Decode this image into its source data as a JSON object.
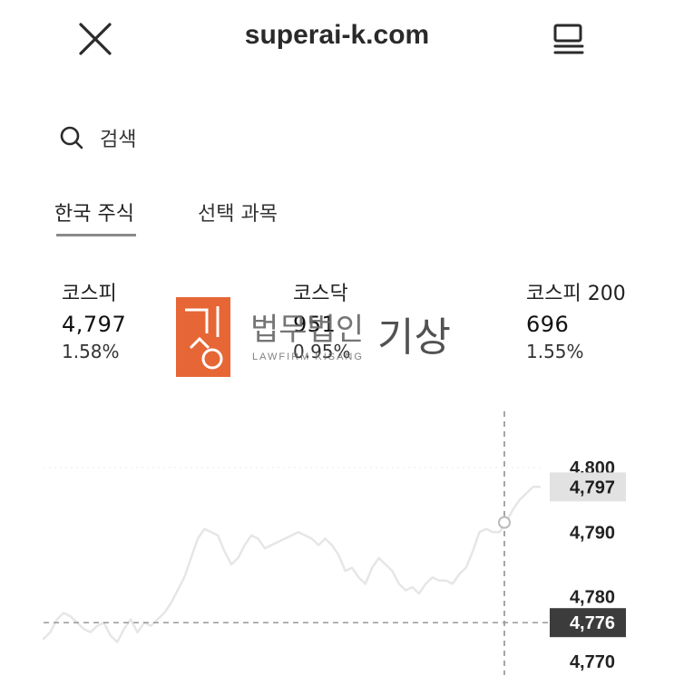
{
  "header": {
    "site_title": "superai-k.com",
    "close_icon": "close-icon",
    "menu_icon": "menu-icon"
  },
  "search": {
    "label": "검색",
    "icon": "search-icon"
  },
  "tabs": [
    {
      "label": "한국 주식",
      "active": true
    },
    {
      "label": "선택 과목",
      "active": false
    }
  ],
  "indices": [
    {
      "name": "코스피",
      "value": "4,797",
      "change": "1.58%"
    },
    {
      "name": "코스닥",
      "value": "951",
      "change": "0.95%"
    },
    {
      "name": "코스피 200",
      "value": "696",
      "change": "1.55%"
    }
  ],
  "watermark": {
    "name": "법무법인",
    "brand": "기상",
    "sub": "LAWFIRM KISANG"
  },
  "chart_data": {
    "type": "line",
    "ylim": [
      4768,
      4802
    ],
    "y_ticks": [
      4800,
      4790,
      4780,
      4770
    ],
    "y_tick_labels": [
      "4,800",
      "4,790",
      "4,780",
      "4,770"
    ],
    "current_value": 4797,
    "current_label": "4,797",
    "reference_value": 4776,
    "reference_label": "4,776",
    "colors": {
      "line": "#e6e6e6",
      "current_bg": "#e2e2e2",
      "reference_bg": "#3c3c3c"
    },
    "series": [
      {
        "values": [
          4773.5,
          4774.5,
          4776.5,
          4777.5,
          4777,
          4776,
          4775,
          4774.5,
          4775.5,
          4776,
          4774,
          4773,
          4775,
          4776.5,
          4774.5,
          4776,
          4775.5,
          4776.5,
          4777.5,
          4779,
          4781,
          4783,
          4786,
          4789,
          4790.5,
          4790,
          4789.5,
          4787,
          4785,
          4786,
          4788,
          4789.5,
          4789,
          4787.5,
          4788,
          4788.5,
          4789,
          4789.5,
          4790,
          4789.5,
          4789,
          4788,
          4789,
          4788,
          4786.5,
          4784,
          4784.5,
          4783,
          4782,
          4784.5,
          4786,
          4785,
          4784,
          4782,
          4781,
          4781.5,
          4780.5,
          4782,
          4783,
          4782.5,
          4782.5,
          4782,
          4783.5,
          4784.5,
          4787,
          4790,
          4790.5,
          4790,
          4790,
          4791.5,
          4793.5,
          4795,
          4796,
          4797,
          4797
        ]
      }
    ]
  }
}
